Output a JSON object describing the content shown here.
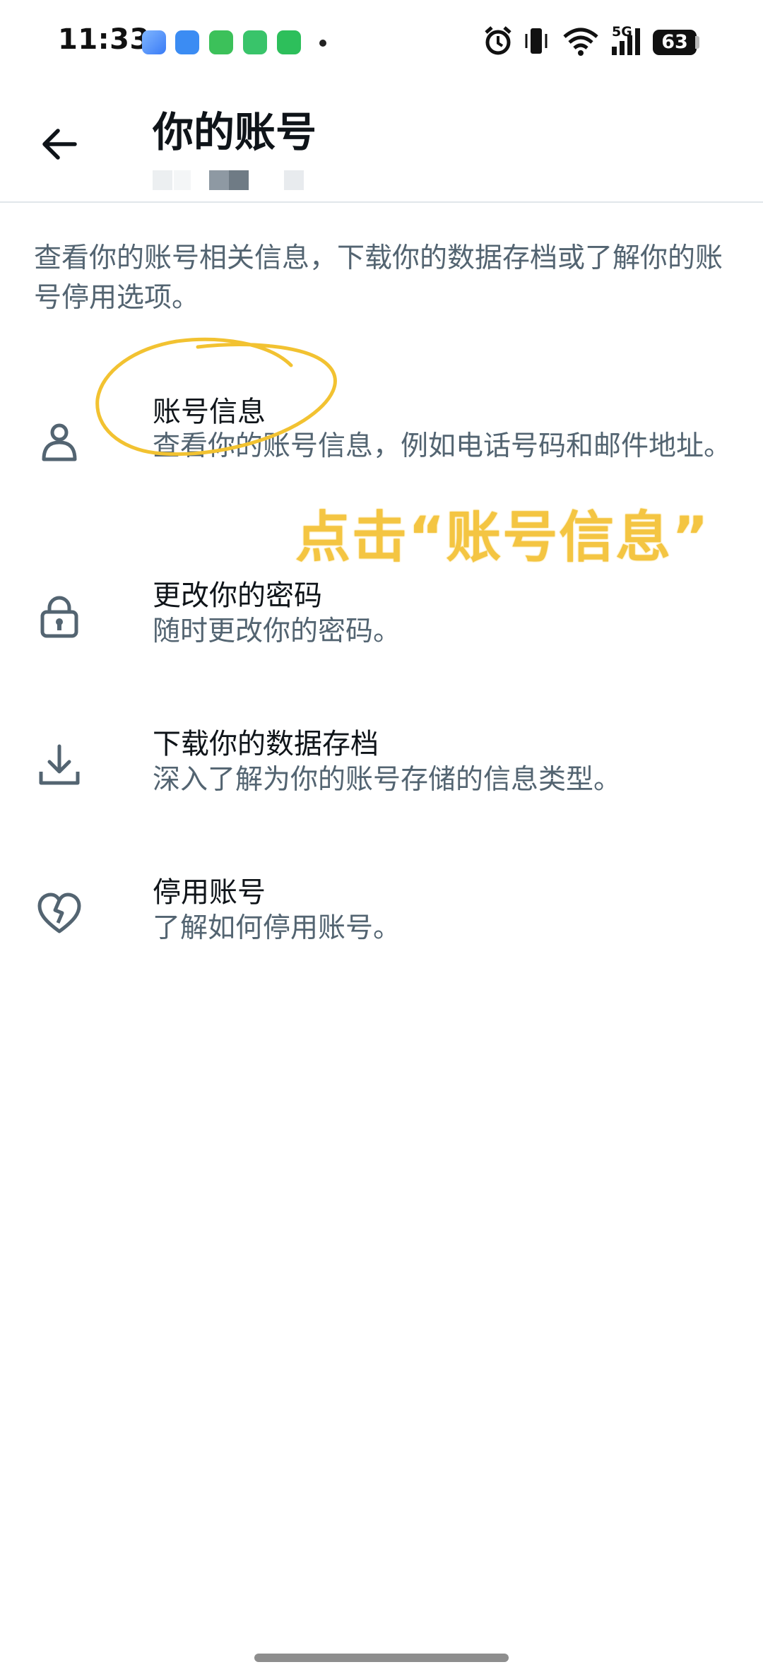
{
  "status_bar": {
    "time": "11:33",
    "network": "5G",
    "battery": "63"
  },
  "header": {
    "back_icon": "arrow-left-icon",
    "title": "你的账号"
  },
  "intro": "查看你的账号相关信息，下载你的数据存档或了解你的账号停用选项。",
  "items": [
    {
      "icon": "person-icon",
      "title": "账号信息",
      "desc": "查看你的账号信息，例如电话号码和邮件地址。"
    },
    {
      "icon": "lock-icon",
      "title": "更改你的密码",
      "desc": "随时更改你的密码。"
    },
    {
      "icon": "download-icon",
      "title": "下载你的数据存档",
      "desc": "深入了解为你的账号存储的信息类型。"
    },
    {
      "icon": "broken-heart-icon",
      "title": "停用账号",
      "desc": "了解如何停用账号。"
    }
  ],
  "annotation": "点击“账号信息”",
  "colors": {
    "text_primary": "#0f1419",
    "text_secondary": "#536471",
    "annotation": "#f4c542"
  }
}
